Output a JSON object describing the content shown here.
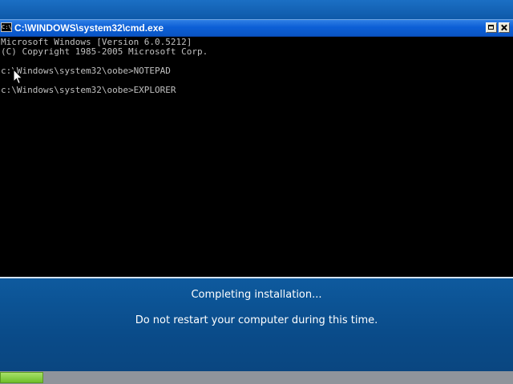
{
  "window": {
    "title": "C:\\WINDOWS\\system32\\cmd.exe",
    "icon": "console-icon",
    "icon_text": "C:\\"
  },
  "console": {
    "lines": [
      "Microsoft Windows [Version 6.0.5212]",
      "(C) Copyright 1985-2005 Microsoft Corp.",
      "c:\\Windows\\system32\\oobe>NOTEPAD",
      "c:\\Windows\\system32\\oobe>EXPLORER"
    ]
  },
  "setup": {
    "status": "Completing installation...",
    "message": "Do not restart your computer during this time."
  },
  "progress": {
    "fraction": 0.085
  },
  "colors": {
    "console_bg": "#000000",
    "console_text": "#c0c0c0",
    "setup_bg": "#0a4b89",
    "progress_fill": "#7ccb34"
  }
}
